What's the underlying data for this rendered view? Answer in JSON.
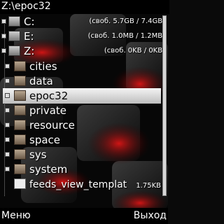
{
  "title": "Z:\\epoc32",
  "drives": [
    {
      "label": "C:",
      "info": "(своб. 5.7GB / 7.4GB)"
    },
    {
      "label": "E:",
      "info": "(своб. 1.0MB / 1.2MB)"
    },
    {
      "label": "Z:",
      "info": "(своб. 0KB / 0KB)"
    }
  ],
  "folders": [
    "cities",
    "data",
    "epoc32",
    "private",
    "resource",
    "space",
    "sys",
    "system"
  ],
  "selected": "epoc32",
  "file": {
    "name": "feeds_view_templat",
    "size": "1.75KB"
  },
  "softkeys": {
    "left": "Меню",
    "right": "Выход"
  },
  "colors": {
    "selection": "#e0e0e0",
    "background": "#0a0a0a",
    "accent_red": "#b01010"
  }
}
